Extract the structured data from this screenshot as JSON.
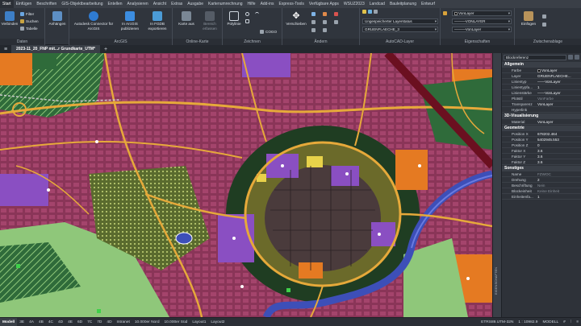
{
  "ribbon_tabs": [
    "Start",
    "Einfügen",
    "Beschriften",
    "GIS-Objektbearbeitung",
    "Entellen",
    "Analysieren",
    "Ansicht",
    "Extras",
    "Ausgabe",
    "Kartenumrechnung",
    "Hilfe",
    "Add-ins",
    "Express-Tools",
    "Verfügbare Apps",
    "WSUZ2023",
    "Landcad",
    "Bauleitplanung",
    "Entwurf"
  ],
  "ribbon": {
    "daten": {
      "title": "Daten",
      "verbinden": "Verbinden",
      "filter": "Filter",
      "suchen": "Suchen",
      "tabelle": "Tabelle",
      "anhaengen": "Anhängen"
    },
    "arcgis": {
      "title": "ArcGIS",
      "connector": "Autodesk Connector für ArcGIS",
      "publizieren": "In ArcGIS publizieren",
      "fgdb": "In FGDB exportieren"
    },
    "online": {
      "title": "Online-Karte",
      "karte_aus": "Karte aus",
      "bereich": "Bereich erfassen"
    },
    "zeichnen": {
      "title": "Zeichnen",
      "polylinie": "Polylinie",
      "cogo": "COGO"
    },
    "aendern": {
      "title": "Ändern",
      "verschieben": "Verschieben"
    },
    "layer": {
      "title": "AutoCAD-Layer",
      "status": "Ungespeicherter Layerstatus",
      "current": "GRUENFLAECHE_3"
    },
    "eigenschaften": {
      "title": "Eigenschaften",
      "vonlayer_color": "VonLayer",
      "linetype": "VONLAYER",
      "lineweight": "VonLayer"
    },
    "zwischenablage": {
      "title": "Zwischenablage",
      "einfuegen": "Einfügen"
    }
  },
  "doc_tab": "2023-11_20_FNP mit...r Grundkarte_UTM*",
  "properties": {
    "selector": "Blockreferenz",
    "sections": [
      {
        "title": "Allgemein",
        "rows": [
          {
            "k": "Farbe",
            "v": "VonLayer",
            "swatch": true
          },
          {
            "k": "Layer",
            "v": "GRUENFLAECHE..."
          },
          {
            "k": "Linientyp",
            "v": "——VonLayer"
          },
          {
            "k": "Linientypfa...",
            "v": "1"
          },
          {
            "k": "Linienstärke",
            "v": "——VonLayer"
          },
          {
            "k": "Transparenz",
            "v": "VonLayer"
          },
          {
            "k": "Hyperlink",
            "v": ""
          }
        ]
      },
      {
        "title": "3D-Visualisierung",
        "rows": [
          {
            "k": "Material",
            "v": "VonLayer"
          }
        ]
      },
      {
        "title": "Geometrie",
        "rows": [
          {
            "k": "Position X",
            "v": "678202.464"
          },
          {
            "k": "Position Y",
            "v": "5402945.553"
          },
          {
            "k": "Position Z",
            "v": "0"
          },
          {
            "k": "Faktor X",
            "v": "3.6"
          },
          {
            "k": "Faktor Y",
            "v": "3.6"
          },
          {
            "k": "Faktor Z",
            "v": "3.6"
          }
        ]
      },
      {
        "title": "Sonstiges",
        "rows": [
          {
            "k": "Name",
            "v": "FZWOC",
            "muted": true
          },
          {
            "k": "Drehung",
            "v": "2"
          },
          {
            "k": "Beschriftung",
            "v": "Nein",
            "muted": true
          },
          {
            "k": "Blockeinheit",
            "v": "Keine Einheit",
            "muted": true
          },
          {
            "k": "Einheitenfa...",
            "v": "1"
          }
        ]
      }
    ]
  },
  "plotstil_row": {
    "k": "Plotstil",
    "v": "VonFarbe"
  },
  "side_palette_label": "EIGENSCHAFTEN",
  "status": {
    "tabs": [
      "Modell",
      "3E",
      "4A",
      "4B",
      "4C",
      "4D",
      "4E",
      "6D",
      "7C",
      "7D",
      "4D",
      "Intranet",
      "10.000er Nord",
      "10.000er Süd",
      "Layout1",
      "Layout2"
    ],
    "coordsys": "ETRS89.UTM-32N",
    "scale": "1 : 10982.9",
    "mode": "MODELL"
  },
  "colors": {
    "map_base": "#4a1e2e",
    "residential": "#8a3558",
    "green": "#2f6b3a",
    "light_green": "#8fc77a",
    "road": "#e6a93a",
    "water": "#3d4fb8",
    "purple": "#8a4fc2",
    "orange": "#e57a22",
    "dark_green": "#1f3d22"
  }
}
